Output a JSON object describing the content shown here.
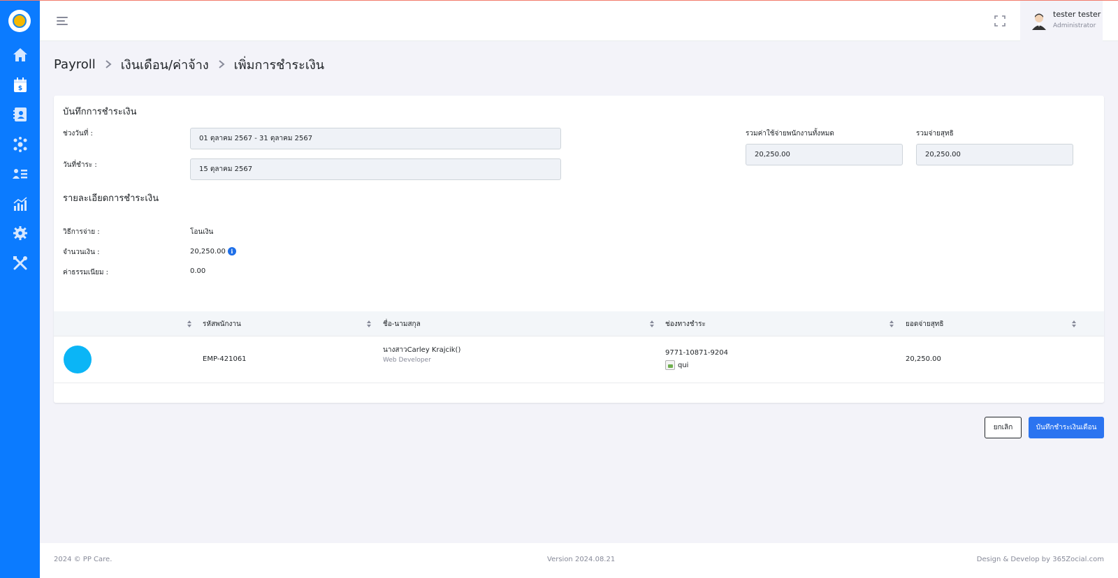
{
  "sidebar": {
    "items": [
      {
        "icon": "home-icon"
      },
      {
        "icon": "payroll-calendar-icon"
      },
      {
        "icon": "contacts-icon"
      },
      {
        "icon": "team-icon"
      },
      {
        "icon": "employee-list-icon"
      },
      {
        "icon": "analytics-icon"
      },
      {
        "icon": "settings-icon"
      },
      {
        "icon": "tools-icon"
      }
    ]
  },
  "header": {
    "user_name": "tester tester",
    "user_role": "Administrator"
  },
  "breadcrumb": {
    "items": [
      "Payroll",
      "เงินเดือน/ค่าจ้าง",
      "เพิ่มการชำระเงิน"
    ]
  },
  "form": {
    "title": "บันทึกการชำระเงิน",
    "period_label": "ช่วงวันที่ :",
    "period_value": "01 ตุลาคม 2567 - 31 ตุลาคม 2567",
    "pay_date_label": "วันที่ชำระ :",
    "pay_date_value": "15 ตุลาคม 2567",
    "total_cost_label": "รวมค่าใช้จ่ายพนักงานทั้งหมด",
    "total_cost_value": "20,250.00",
    "total_net_label": "รวมจ่ายสุทธิ",
    "total_net_value": "20,250.00"
  },
  "details": {
    "title": "รายละเอียดการชำระเงิน",
    "method_label": "วิธีการจ่าย :",
    "method_value": "โอนเงิน",
    "amount_label": "จำนวนเงิน :",
    "amount_value": "20,250.00",
    "amount_info": "i",
    "fee_label": "ค่าธรรมเนียม :",
    "fee_value": "0.00"
  },
  "table": {
    "headers": [
      "รหัสพนักงาน",
      "ชื่อ-นามสกุล",
      "ช่องทางชำระ",
      "ยอดจ่ายสุทธิ"
    ],
    "rows": [
      {
        "employee_id": "EMP-421061",
        "name": "นางสาวCarley Krajcik()",
        "position": "Web Developer",
        "account": "9771-10871-9204",
        "bank": "qui",
        "net_pay": "20,250.00"
      }
    ]
  },
  "buttons": {
    "cancel": "ยกเลิก",
    "save": "บันทึกชำระเงินเดือน"
  },
  "footer": {
    "copyright": "2024 © PP Care.",
    "version": "Version 2024.08.21",
    "credit": "Design & Develop by 365Zocial.com"
  },
  "colors": {
    "sidebar": "#0b7bff",
    "primary_button": "#2b74f0",
    "avatar": "#0bb5f6"
  }
}
